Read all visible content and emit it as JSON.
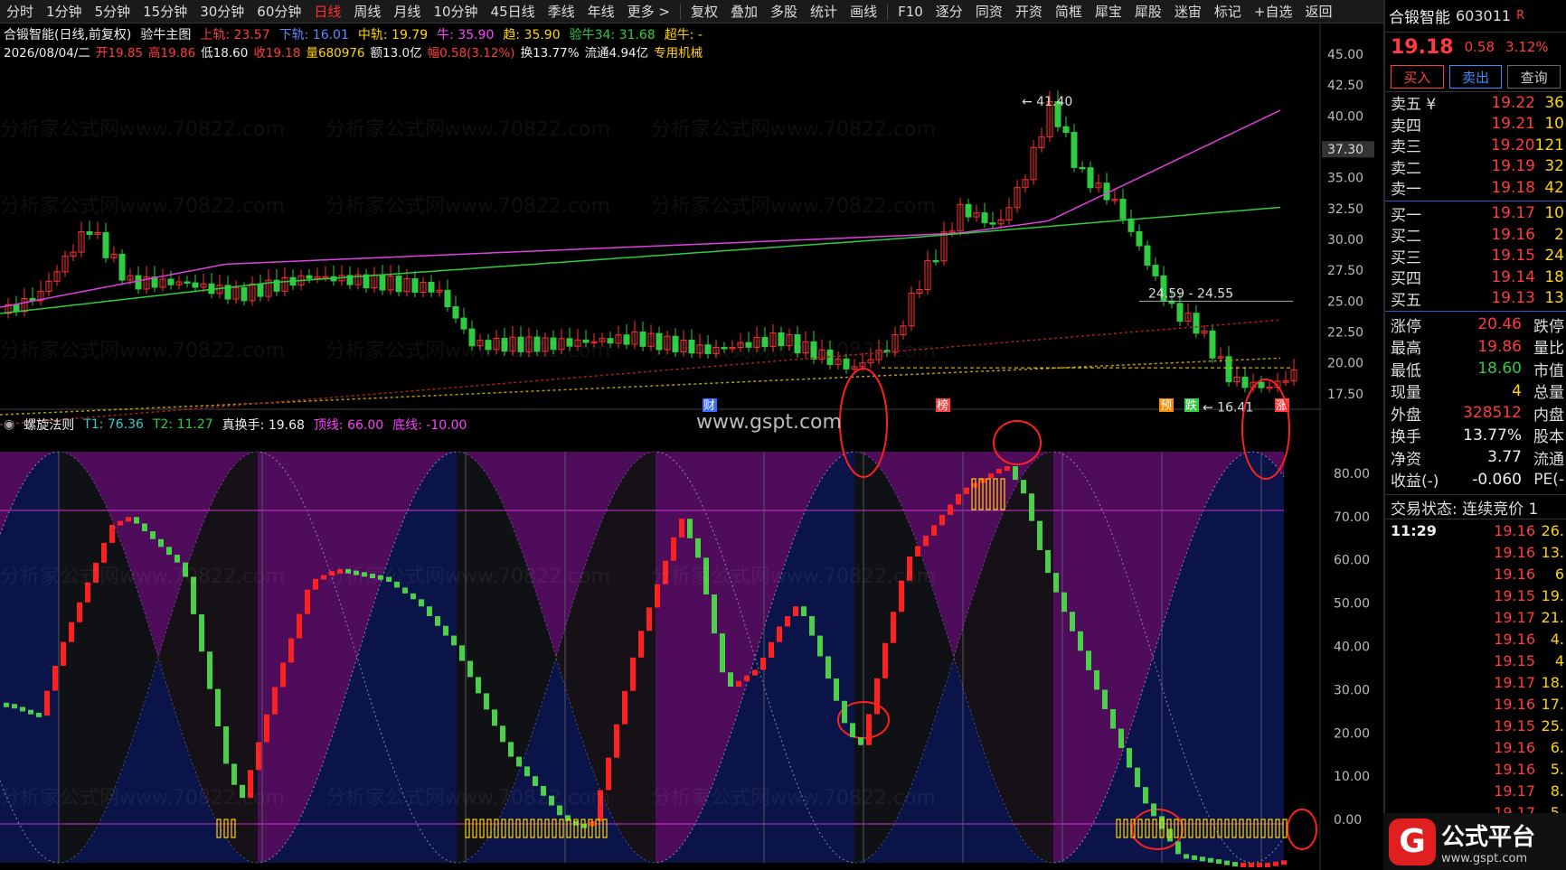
{
  "toolbar": {
    "items": [
      "分时",
      "1分钟",
      "5分钟",
      "15分钟",
      "30分钟",
      "60分钟",
      "日线",
      "周线",
      "月线",
      "10分钟",
      "45日线",
      "季线",
      "年线",
      "更多 >",
      "复权",
      "叠加",
      "多股",
      "统计",
      "画线",
      "F10",
      "逐分",
      "同资",
      "开资",
      "简框",
      "犀宝",
      "犀股",
      "迷宙",
      "标记",
      "+自选",
      "返回"
    ],
    "active": "日线"
  },
  "main_chart": {
    "title": "合锻智能(日线,前复权)",
    "indicator_name": "验牛主图",
    "upper_rail": "上轨: 23.57",
    "lower_rail": "下轨: 16.01",
    "mid_rail": "中轨: 19.79",
    "bull": "牛: 35.90",
    "trend": "趋: 35.90",
    "bull34": "验牛34: 31.68",
    "super_bull": "超牛: -",
    "date": "2026/08/04/二",
    "open": "开19.85",
    "high": "高19.86",
    "low": "低18.60",
    "close": "收19.18",
    "volume": "量680976",
    "amount": "额13.0亿",
    "change": "幅0.58(3.12%)",
    "turnover": "换13.77%",
    "float": "流通4.94亿",
    "sector": "专用机械",
    "price_axis": [
      "45.00",
      "42.50",
      "40.00",
      "37.30",
      "35.00",
      "32.50",
      "30.00",
      "27.50",
      "25.00",
      "22.50",
      "20.00",
      "17.50"
    ],
    "cursor_price": "37.30",
    "annotations": {
      "high": "41.40",
      "low": "16.41",
      "range": "24.59 - 24.55"
    },
    "markers": [
      "财",
      "榜",
      "预",
      "跌",
      "涨"
    ]
  },
  "sub_chart": {
    "name": "螺旋法则",
    "t1": "T1: 76.36",
    "t2": "T2: 11.27",
    "true_turnover": "真换手: 19.68",
    "top_line": "顶线: 66.00",
    "bottom_line": "底线: -10.00",
    "axis": [
      "80.00",
      "70.00",
      "60.00",
      "50.00",
      "40.00",
      "30.00",
      "20.00",
      "10.00",
      "0.00"
    ]
  },
  "watermark": {
    "site": "www.gspt.com",
    "repeat": "分析家公式网www.70822.com"
  },
  "quote_panel": {
    "name": "合锻智能",
    "code": "603011",
    "flag": "R",
    "price": "19.18",
    "change": "0.58",
    "pct": "3.12%",
    "buttons": {
      "buy": "买入",
      "sell": "卖出",
      "query": "查询"
    },
    "asks": [
      {
        "label": "卖五 ¥",
        "price": "19.22",
        "vol": "36"
      },
      {
        "label": "卖四",
        "price": "19.21",
        "vol": "10"
      },
      {
        "label": "卖三",
        "price": "19.20",
        "vol": "121"
      },
      {
        "label": "卖二",
        "price": "19.19",
        "vol": "32"
      },
      {
        "label": "卖一",
        "price": "19.18",
        "vol": "42"
      }
    ],
    "bids": [
      {
        "label": "买一",
        "price": "19.17",
        "vol": "10"
      },
      {
        "label": "买二",
        "price": "19.16",
        "vol": "2"
      },
      {
        "label": "买三",
        "price": "19.15",
        "vol": "24"
      },
      {
        "label": "买四",
        "price": "19.14",
        "vol": "18"
      },
      {
        "label": "买五",
        "price": "19.13",
        "vol": "13"
      }
    ],
    "stats": [
      {
        "label": "涨停",
        "value": "20.46",
        "color": "#ff3b3b",
        "label2": "跌停"
      },
      {
        "label": "最高",
        "value": "19.86",
        "color": "#ff3b3b",
        "label2": "量比"
      },
      {
        "label": "最低",
        "value": "18.60",
        "color": "#2ecc40",
        "label2": "市值"
      },
      {
        "label": "现量",
        "value": "4",
        "color": "#ffd400",
        "label2": "总量"
      },
      {
        "label": "外盘",
        "value": "328512",
        "color": "#ff3b3b",
        "label2": "内盘"
      },
      {
        "label": "换手",
        "value": "13.77%",
        "color": "#eeeeee",
        "label2": "股本"
      },
      {
        "label": "净资",
        "value": "3.77",
        "color": "#eeeeee",
        "label2": "流通"
      },
      {
        "label": "收益(-)",
        "value": "-0.060",
        "color": "#eeeeee",
        "label2": "PE(-"
      }
    ],
    "trade_state": "交易状态: 连续竞价 1",
    "ticks": [
      {
        "time": "11:29",
        "price": "19.16",
        "vol": "26."
      },
      {
        "time": "",
        "price": "19.16",
        "vol": "13."
      },
      {
        "time": "",
        "price": "19.16",
        "vol": "6"
      },
      {
        "time": "",
        "price": "19.15",
        "vol": "19."
      },
      {
        "time": "",
        "price": "19.17",
        "vol": "21."
      },
      {
        "time": "",
        "price": "19.16",
        "vol": "4."
      },
      {
        "time": "",
        "price": "19.15",
        "vol": "4"
      },
      {
        "time": "",
        "price": "19.17",
        "vol": "18."
      },
      {
        "time": "",
        "price": "19.16",
        "vol": "17."
      },
      {
        "time": "",
        "price": "19.15",
        "vol": "25."
      },
      {
        "time": "",
        "price": "19.16",
        "vol": "6."
      },
      {
        "time": "",
        "price": "19.16",
        "vol": "5."
      },
      {
        "time": "",
        "price": "19.17",
        "vol": "8."
      },
      {
        "time": "",
        "price": "19.17",
        "vol": "5."
      }
    ]
  },
  "logo": {
    "text": "公式平台",
    "url": "www.gspt.com"
  }
}
